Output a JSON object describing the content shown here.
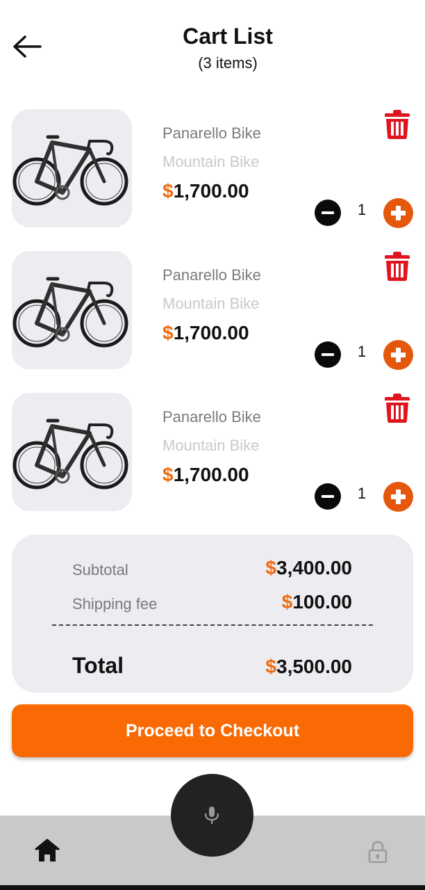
{
  "header": {
    "title": "Cart List",
    "subtitle": "(3 items)",
    "back_icon": "arrow-left-icon"
  },
  "items": [
    {
      "name": "Panarello Bike",
      "category": "Mountain Bike",
      "currency": "$",
      "price": "1,700.00",
      "quantity": "1"
    },
    {
      "name": "Panarello Bike",
      "category": "Mountain Bike",
      "currency": "$",
      "price": "1,700.00",
      "quantity": "1"
    },
    {
      "name": "Panarello Bike",
      "category": "Mountain Bike",
      "currency": "$",
      "price": "1,700.00",
      "quantity": "1"
    }
  ],
  "summary": {
    "subtotal_label": "Subtotal",
    "subtotal_currency": "$",
    "subtotal_value": "3,400.00",
    "shipping_label": "Shipping fee",
    "shipping_currency": "$",
    "shipping_value": "100.00",
    "total_label": "Total",
    "total_currency": "$",
    "total_value": "3,500.00"
  },
  "checkout": {
    "label": "Proceed to Checkout"
  },
  "nav": {
    "home_icon": "home-icon",
    "mic_icon": "microphone-icon",
    "lock_icon": "lock-icon"
  },
  "colors": {
    "accent": "#F96A04",
    "plus_button": "#E4570C",
    "delete_icon": "#E0141E",
    "card_background": "#ECECF1",
    "nav_background": "#C9C9C9"
  }
}
